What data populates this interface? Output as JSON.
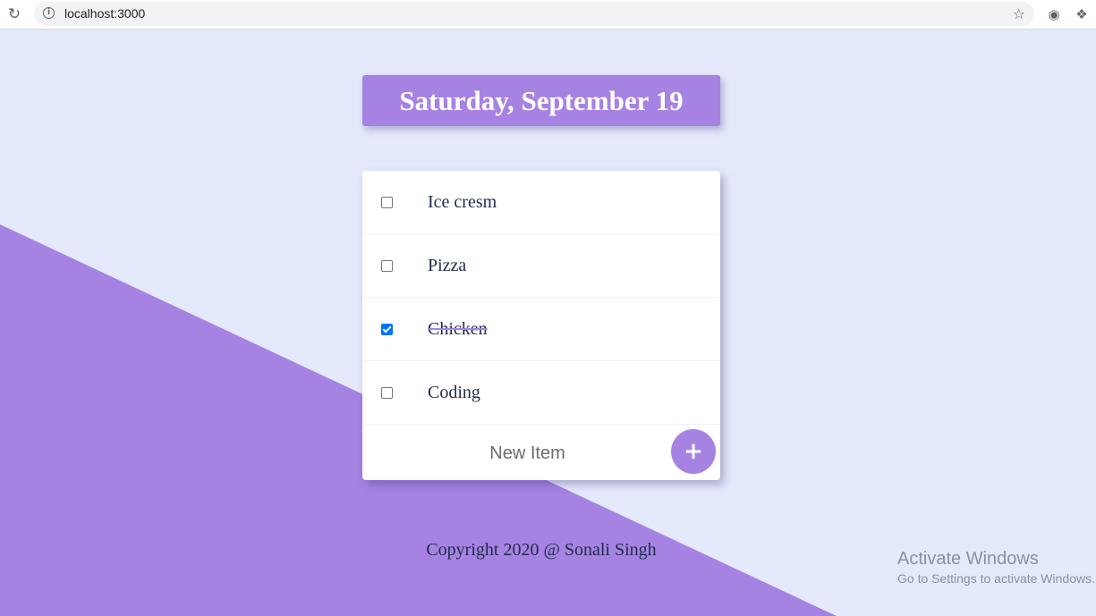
{
  "browser": {
    "url": "localhost:3000",
    "icons": {
      "reload": "reload-icon",
      "info": "info-icon",
      "bookmark": "star-icon",
      "extension_bug": "bug-icon",
      "extensions": "puzzle-icon"
    }
  },
  "colors": {
    "accent": "#A683E3",
    "background": "#E4E9FC",
    "checkbox_checked": "#0075FF"
  },
  "header": {
    "title": "Saturday, September 19"
  },
  "todo": {
    "items": [
      {
        "text": "Ice cresm",
        "checked": false
      },
      {
        "text": "Pizza",
        "checked": false
      },
      {
        "text": "Chicken",
        "checked": true
      },
      {
        "text": "Coding",
        "checked": false
      }
    ],
    "new_item_placeholder": "New Item",
    "add_label": "+"
  },
  "footer": {
    "text": "Copyright 2020 @ Sonali Singh"
  },
  "watermark": {
    "title": "Activate Windows",
    "subtitle": "Go to Settings to activate Windows."
  }
}
